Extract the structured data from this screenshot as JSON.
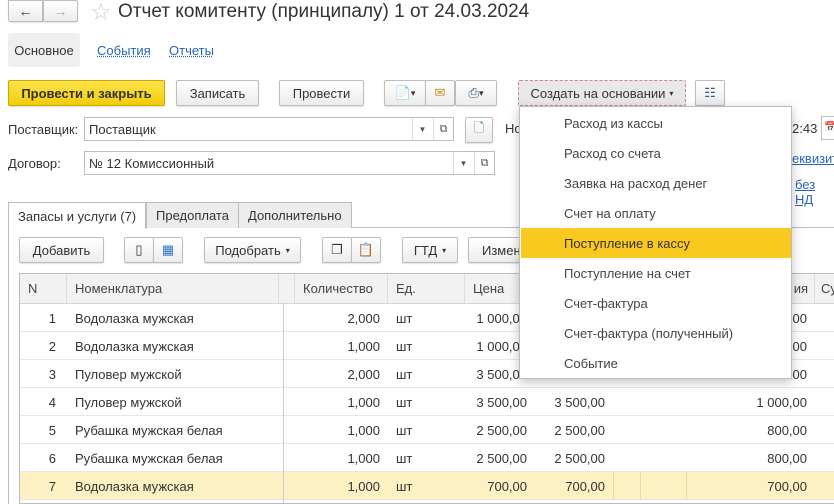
{
  "header": {
    "title": "Отчет комитенту (принципалу) 1 от 24.03.2024"
  },
  "nav_tabs": [
    {
      "label": "Основное",
      "active": true
    },
    {
      "label": "События"
    },
    {
      "label": "Отчеты"
    }
  ],
  "toolbar": {
    "post_close": "Провести и закрыть",
    "save": "Записать",
    "post": "Провести",
    "create_based": "Создать на основании"
  },
  "form": {
    "supplier_label": "Поставщик:",
    "supplier_value": "Поставщик",
    "contract_label": "Договор:",
    "contract_value": "№ 12 Комиссионный",
    "number_label_partial": "Но",
    "time_partial": "2:43",
    "link1_partial": "еквизит",
    "link2_partial": "без НД"
  },
  "doc_tabs": [
    {
      "label": "Запасы и услуги (7)",
      "active": true
    },
    {
      "label": "Предоплата"
    },
    {
      "label": "Дополнительно"
    }
  ],
  "table_toolbar": {
    "add": "Добавить",
    "pick": "Подобрать",
    "gtd": "ГТД",
    "change_partial": "Измен"
  },
  "table": {
    "columns": [
      "N",
      "Номенклатура",
      "Количество",
      "Ед.",
      "Цена",
      "ия",
      "Су"
    ],
    "rows": [
      {
        "n": "1",
        "name": "Водолазка мужская",
        "qty": "2,000",
        "unit": "шт",
        "price": "1 000,00",
        "sum": "",
        "last": "00"
      },
      {
        "n": "2",
        "name": "Водолазка мужская",
        "qty": "1,000",
        "unit": "шт",
        "price": "1 000,00",
        "sum": "",
        "last": "00"
      },
      {
        "n": "3",
        "name": "Пуловер мужской",
        "qty": "2,000",
        "unit": "шт",
        "price": "3 500,00",
        "sum": "",
        "last": "00"
      },
      {
        "n": "4",
        "name": "Пуловер мужской",
        "qty": "1,000",
        "unit": "шт",
        "price": "3 500,00",
        "sum": "3 500,00",
        "last": "1 000,00"
      },
      {
        "n": "5",
        "name": "Рубашка мужская белая",
        "qty": "1,000",
        "unit": "шт",
        "price": "2 500,00",
        "sum": "2 500,00",
        "last": "800,00"
      },
      {
        "n": "6",
        "name": "Рубашка мужская белая",
        "qty": "1,000",
        "unit": "шт",
        "price": "2 500,00",
        "sum": "2 500,00",
        "last": "800,00"
      },
      {
        "n": "7",
        "name": "Водолазка мужская",
        "qty": "1,000",
        "unit": "шт",
        "price": "700,00",
        "sum": "700,00",
        "last": "700,00",
        "selected": true
      }
    ]
  },
  "dropdown_menu": {
    "items": [
      "Расход из кассы",
      "Расход со счета",
      "Заявка на расход денег",
      "Счет на оплату",
      "Поступление в кассу",
      "Поступление на счет",
      "Счет-фактура",
      "Счет-фактура (полученный)",
      "Событие"
    ],
    "highlighted": "Поступление в кассу"
  },
  "colors": {
    "accent": "#f9c91f",
    "selected_row": "#fdf0c3",
    "link": "#2b63b5"
  }
}
